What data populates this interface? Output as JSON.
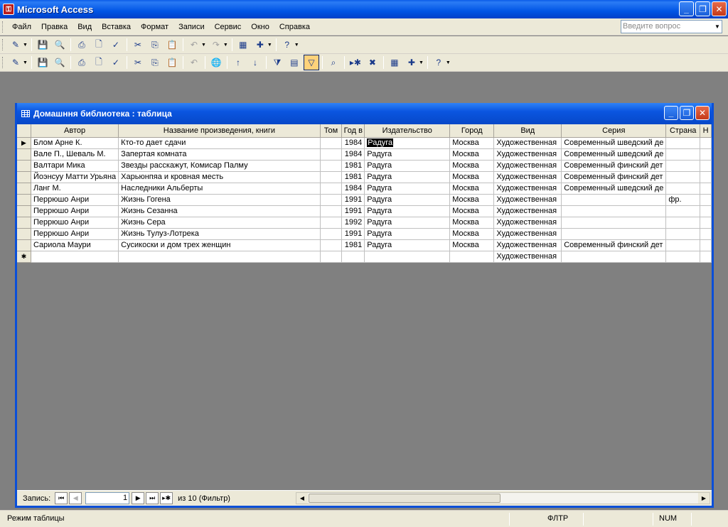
{
  "app": {
    "title": "Microsoft Access",
    "minimize": "_",
    "restore": "❐",
    "close": "✕"
  },
  "menu": {
    "items": [
      "Файл",
      "Правка",
      "Вид",
      "Вставка",
      "Формат",
      "Записи",
      "Сервис",
      "Окно",
      "Справка"
    ],
    "ask_placeholder": "Введите вопрос"
  },
  "child": {
    "title": "Домашння библиотека : таблица"
  },
  "grid": {
    "columns": [
      "Автор",
      "Название произведения, книги",
      "Том",
      "Год в",
      "Издательство",
      "Город",
      "Вид",
      "Серия",
      "Страна",
      "Н"
    ],
    "rows": [
      [
        "Блом Арне К.",
        "Кто-то дает сдачи",
        "",
        "1984",
        "Радуга",
        "Москва",
        "Художественная",
        "Современный шведский де",
        ""
      ],
      [
        "Вале П., Шеваль М.",
        "Запертая комната",
        "",
        "1984",
        "Радуга",
        "Москва",
        "Художественная",
        "Современный шведский де",
        ""
      ],
      [
        "Валтари Мика",
        "Звезды расскажут, Комисар Палму",
        "",
        "1981",
        "Радуга",
        "Москва",
        "Художественная",
        "Современный финский дет",
        ""
      ],
      [
        "Йоэнсуу Матти Урьяна",
        "Харьюнпяа и кровная месть",
        "",
        "1981",
        "Радуга",
        "Москва",
        "Художественная",
        "Современный финский дет",
        ""
      ],
      [
        "Ланг М.",
        "Наследники Альберты",
        "",
        "1984",
        "Радуга",
        "Москва",
        "Художественная",
        "Современный шведский де",
        ""
      ],
      [
        "Перрюшо Анри",
        "Жизнь Гогена",
        "",
        "1991",
        "Радуга",
        "Москва",
        "Художественная",
        "",
        "фр."
      ],
      [
        "Перрюшо Анри",
        "Жизнь Сезанна",
        "",
        "1991",
        "Радуга",
        "Москва",
        "Художественная",
        "",
        ""
      ],
      [
        "Перрюшо Анри",
        "Жизнь Сера",
        "",
        "1992",
        "Радуга",
        "Москва",
        "Художественная",
        "",
        ""
      ],
      [
        "Перрюшо Анри",
        "Жизнь Тулуз-Лотрека",
        "",
        "1991",
        "Радуга",
        "Москва",
        "Художественная",
        "",
        ""
      ],
      [
        "Сариола  Маури",
        "Сусикоски и дом трех женщин",
        "",
        "1981",
        "Радуга",
        "Москва",
        "Художественная",
        "Современный финский дет",
        ""
      ]
    ],
    "new_row": [
      "",
      "",
      "",
      "",
      "",
      "",
      "Художественная",
      "",
      ""
    ],
    "current_marker": "▶",
    "new_marker": "✱"
  },
  "nav": {
    "label": "Запись:",
    "current": "1",
    "of_text": "из  10 (Фильтр)"
  },
  "status": {
    "mode": "Режим таблицы",
    "filter": "ФЛТР",
    "num": "NUM"
  }
}
